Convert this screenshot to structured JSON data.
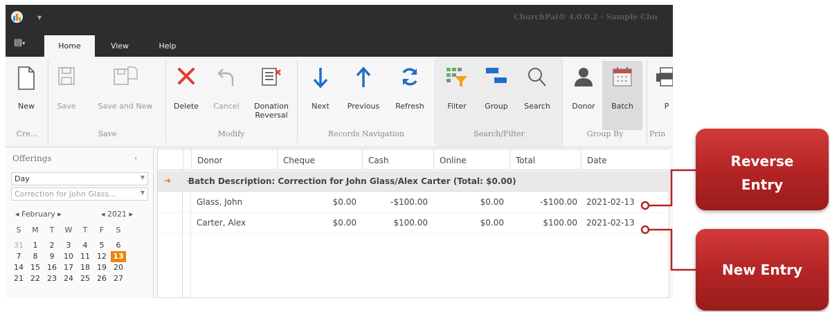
{
  "window": {
    "title": "ChurchPal® 4.0.0.2 - Sample Chu"
  },
  "tabs": [
    {
      "label": "Home",
      "active": true
    },
    {
      "label": "View",
      "active": false
    },
    {
      "label": "Help",
      "active": false
    }
  ],
  "ribbon": {
    "buttons": {
      "new": "New",
      "save": "Save",
      "save_and_new": "Save and New",
      "delete": "Delete",
      "cancel": "Cancel",
      "donation_reversal_1": "Donation",
      "donation_reversal_2": "Reversal",
      "next": "Next",
      "previous": "Previous",
      "refresh": "Refresh",
      "filter": "Filter",
      "group": "Group",
      "search": "Search",
      "donor": "Donor",
      "batch": "Batch",
      "print": "P"
    },
    "groups": {
      "create": "Cre...",
      "save": "Save",
      "modify": "Modify",
      "records_navigation": "Records Navigation",
      "search_filter": "Search/Filter",
      "group_by": "Group By",
      "print": "Prin"
    }
  },
  "left_panel": {
    "title": "Offerings",
    "period": "Day",
    "batch_filter": "Correction for John Glass...",
    "calendar": {
      "month": "February",
      "year": "2021",
      "weekday_headers": [
        "S",
        "M",
        "T",
        "W",
        "T",
        "F",
        "S"
      ],
      "weeks": [
        [
          "31",
          "1",
          "2",
          "3",
          "4",
          "5",
          "6"
        ],
        [
          "7",
          "8",
          "9",
          "10",
          "11",
          "12",
          "13"
        ],
        [
          "14",
          "15",
          "16",
          "17",
          "18",
          "19",
          "20"
        ],
        [
          "21",
          "22",
          "23",
          "24",
          "25",
          "26",
          "27"
        ]
      ],
      "selected_day": "13"
    }
  },
  "grid": {
    "columns": [
      "Donor",
      "Cheque",
      "Cash",
      "Online",
      "Total",
      "Date"
    ],
    "group_row": "Batch Description: Correction for John Glass/Alex Carter (Total: $0.00)",
    "rows": [
      {
        "donor": "Glass, John",
        "cheque": "$0.00",
        "cash": "-$100.00",
        "online": "$0.00",
        "total": "-$100.00",
        "date": "2021-02-13"
      },
      {
        "donor": "Carter, Alex",
        "cheque": "$0.00",
        "cash": "$100.00",
        "online": "$0.00",
        "total": "$100.00",
        "date": "2021-02-13"
      }
    ]
  },
  "callouts": {
    "reverse_line1": "Reverse",
    "reverse_line2": "Entry",
    "new_entry": "New Entry"
  },
  "colors": {
    "titlebar": "#2d2d2d",
    "accent_orange": "#f0820f",
    "delete_red": "#e03c31",
    "nav_blue": "#1e6fc6",
    "callout_red": "#b22424"
  }
}
